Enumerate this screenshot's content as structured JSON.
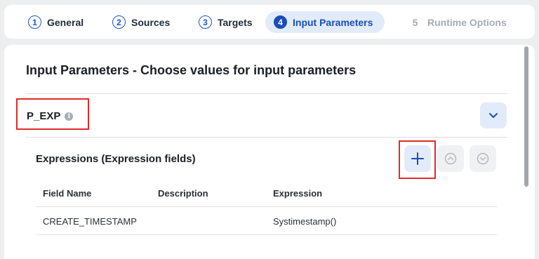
{
  "stepper": {
    "steps": [
      {
        "number": "1",
        "label": "General",
        "state": "completed"
      },
      {
        "number": "2",
        "label": "Sources",
        "state": "completed"
      },
      {
        "number": "3",
        "label": "Targets",
        "state": "completed"
      },
      {
        "number": "4",
        "label": "Input Parameters",
        "state": "active"
      },
      {
        "number": "5",
        "label": "Runtime Options",
        "state": "disabled"
      }
    ]
  },
  "page": {
    "title": "Input Parameters - Choose values for input parameters"
  },
  "parameter": {
    "name": "P_EXP",
    "info_icon": "info-icon",
    "toggle_icon": "chevron-down-icon"
  },
  "expressions": {
    "title": "Expressions (Expression fields)",
    "actions": {
      "add_icon": "plus-icon",
      "move_up_icon": "arrow-up-circle-icon",
      "move_down_icon": "arrow-down-circle-icon"
    },
    "columns": [
      "Field Name",
      "Description",
      "Expression"
    ],
    "rows": [
      {
        "field_name": "CREATE_TIMESTAMP",
        "description": "",
        "expression": "Systimestamp()"
      }
    ]
  },
  "colors": {
    "accent": "#1a4db8",
    "highlight": "#e02b2b",
    "active_bg": "#e1ebfa"
  }
}
